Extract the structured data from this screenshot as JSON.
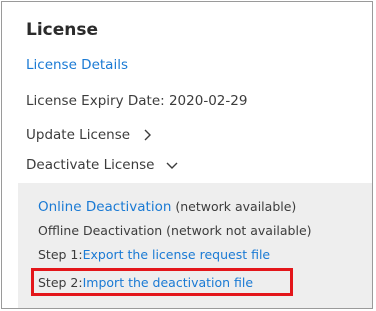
{
  "license": {
    "title": "License",
    "details_link": "License Details",
    "expiry_text": "License Expiry Date: 2020-02-29",
    "update_label": "Update License",
    "deactivate_label": "Deactivate License"
  },
  "deactivation_panel": {
    "online_link": "Online Deactivation",
    "online_note": " (network available)",
    "offline_text": "Offline Deactivation (network not available)",
    "step1_prefix": "Step 1:",
    "step1_link": "Export the license request file",
    "step2_prefix": "Step 2:",
    "step2_link": "Import the deactivation file"
  },
  "icons": {
    "update_chevron": "chevron-right-icon",
    "deactivate_chevron": "chevron-down-icon"
  },
  "colors": {
    "link": "#1a7ad4",
    "text": "#3c3c3c",
    "panel_bg": "#eeeeee",
    "highlight": "#e3161a"
  }
}
